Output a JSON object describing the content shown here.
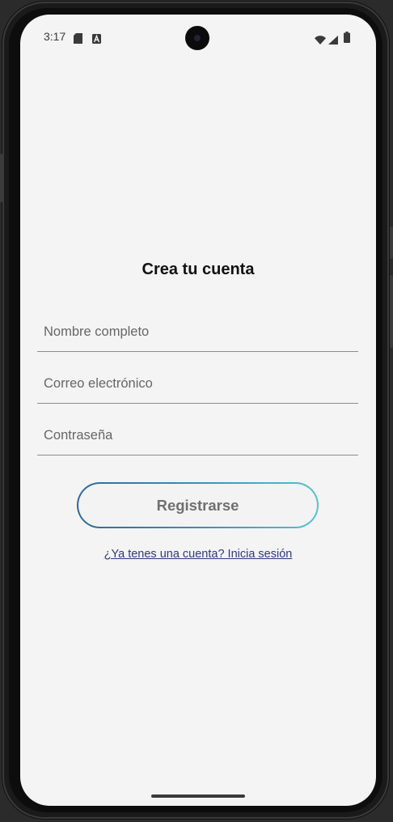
{
  "status_bar": {
    "time": "3:17",
    "left_icons": [
      "sd-card-icon",
      "font-icon"
    ],
    "right_icons": [
      "wifi-icon",
      "signal-icon",
      "battery-icon"
    ]
  },
  "form": {
    "title": "Crea tu cuenta",
    "fields": [
      {
        "name": "full-name",
        "placeholder": "Nombre completo",
        "value": ""
      },
      {
        "name": "email",
        "placeholder": "Correo electrónico",
        "value": ""
      },
      {
        "name": "password",
        "placeholder": "Contraseña",
        "value": ""
      }
    ],
    "register_label": "Registrarse",
    "login_link": "¿Ya tenes una cuenta? Inicia sesión"
  },
  "colors": {
    "background": "#f4f4f4",
    "button_gradient_start": "#2f6a9a",
    "button_gradient_end": "#56c2d0",
    "link": "#2e3a7a"
  }
}
